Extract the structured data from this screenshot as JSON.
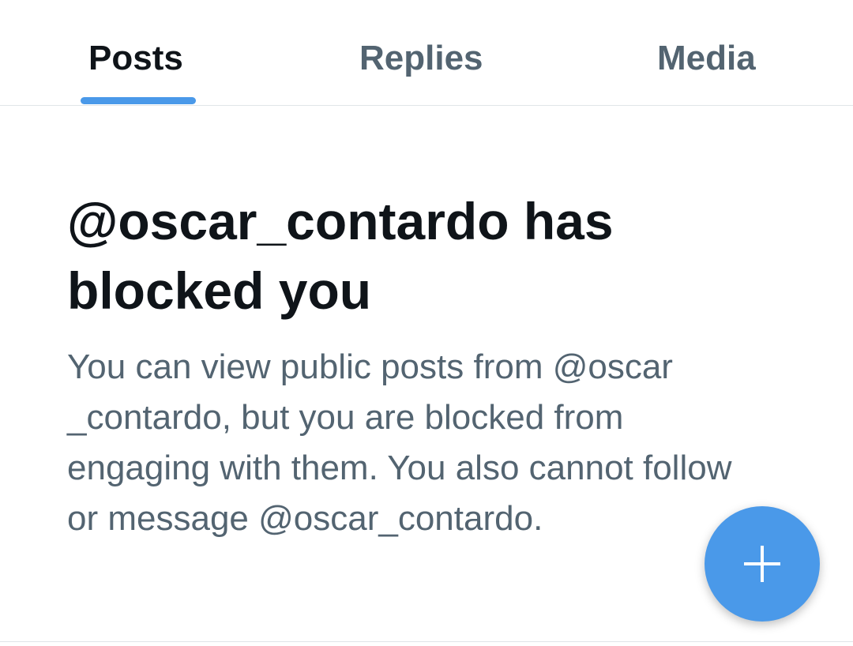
{
  "tabs": [
    {
      "label": "Posts",
      "active": true
    },
    {
      "label": "Replies",
      "active": false
    },
    {
      "label": "Media",
      "active": false
    }
  ],
  "block_notice": {
    "title": "@oscar_contardo has blocked you",
    "description": "You can view public posts from @oscar _contardo, but you are blocked from engaging with them. You also cannot follow or message @oscar_contardo."
  },
  "fab": {
    "icon": "plus-icon"
  },
  "colors": {
    "accent": "#4a99e9",
    "text_primary": "#0f1419",
    "text_secondary": "#536471",
    "divider": "#e1e5e8"
  }
}
